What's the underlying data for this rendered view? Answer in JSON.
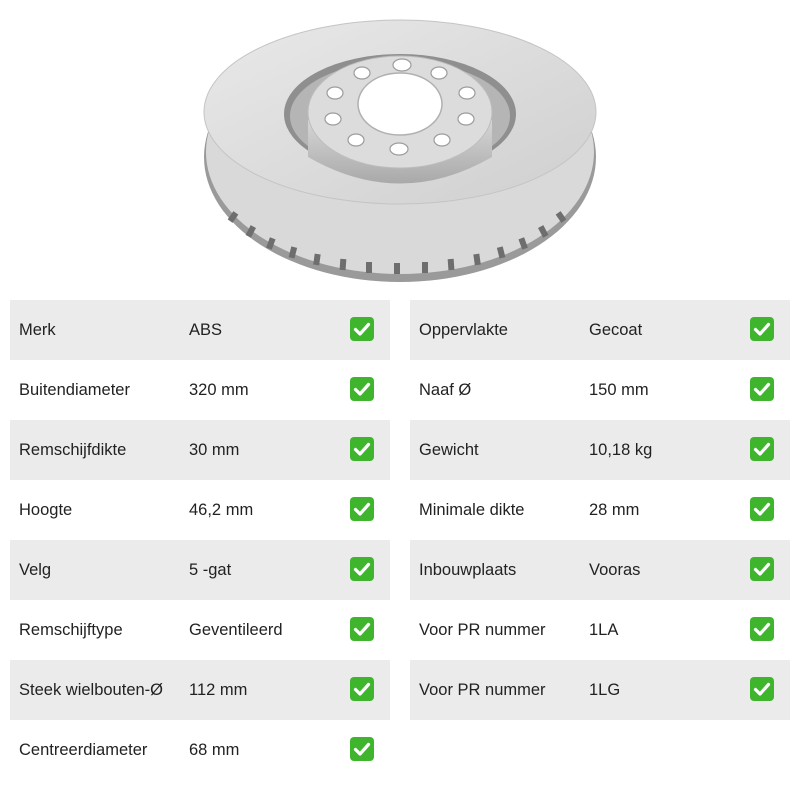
{
  "specs_left": [
    {
      "label": "Merk",
      "value": "ABS"
    },
    {
      "label": "Buitendiameter",
      "value": "320 mm"
    },
    {
      "label": "Remschijfdikte",
      "value": "30 mm"
    },
    {
      "label": "Hoogte",
      "value": "46,2 mm"
    },
    {
      "label": "Velg",
      "value": "5 -gat"
    },
    {
      "label": "Remschijftype",
      "value": "Geventileerd"
    },
    {
      "label": "Steek wielbouten-Ø",
      "value": "112 mm"
    },
    {
      "label": "Centreerdiameter",
      "value": "68 mm"
    }
  ],
  "specs_right": [
    {
      "label": "Oppervlakte",
      "value": "Gecoat"
    },
    {
      "label": "Naaf Ø",
      "value": "150 mm"
    },
    {
      "label": "Gewicht",
      "value": "10,18 kg"
    },
    {
      "label": "Minimale dikte",
      "value": "28 mm"
    },
    {
      "label": "Inbouwplaats",
      "value": "Vooras"
    },
    {
      "label": "Voor PR nummer",
      "value": "1LA"
    },
    {
      "label": "Voor PR nummer",
      "value": "1LG"
    }
  ],
  "check_icon": "check-mark-icon",
  "check_color": "#3fb52e"
}
